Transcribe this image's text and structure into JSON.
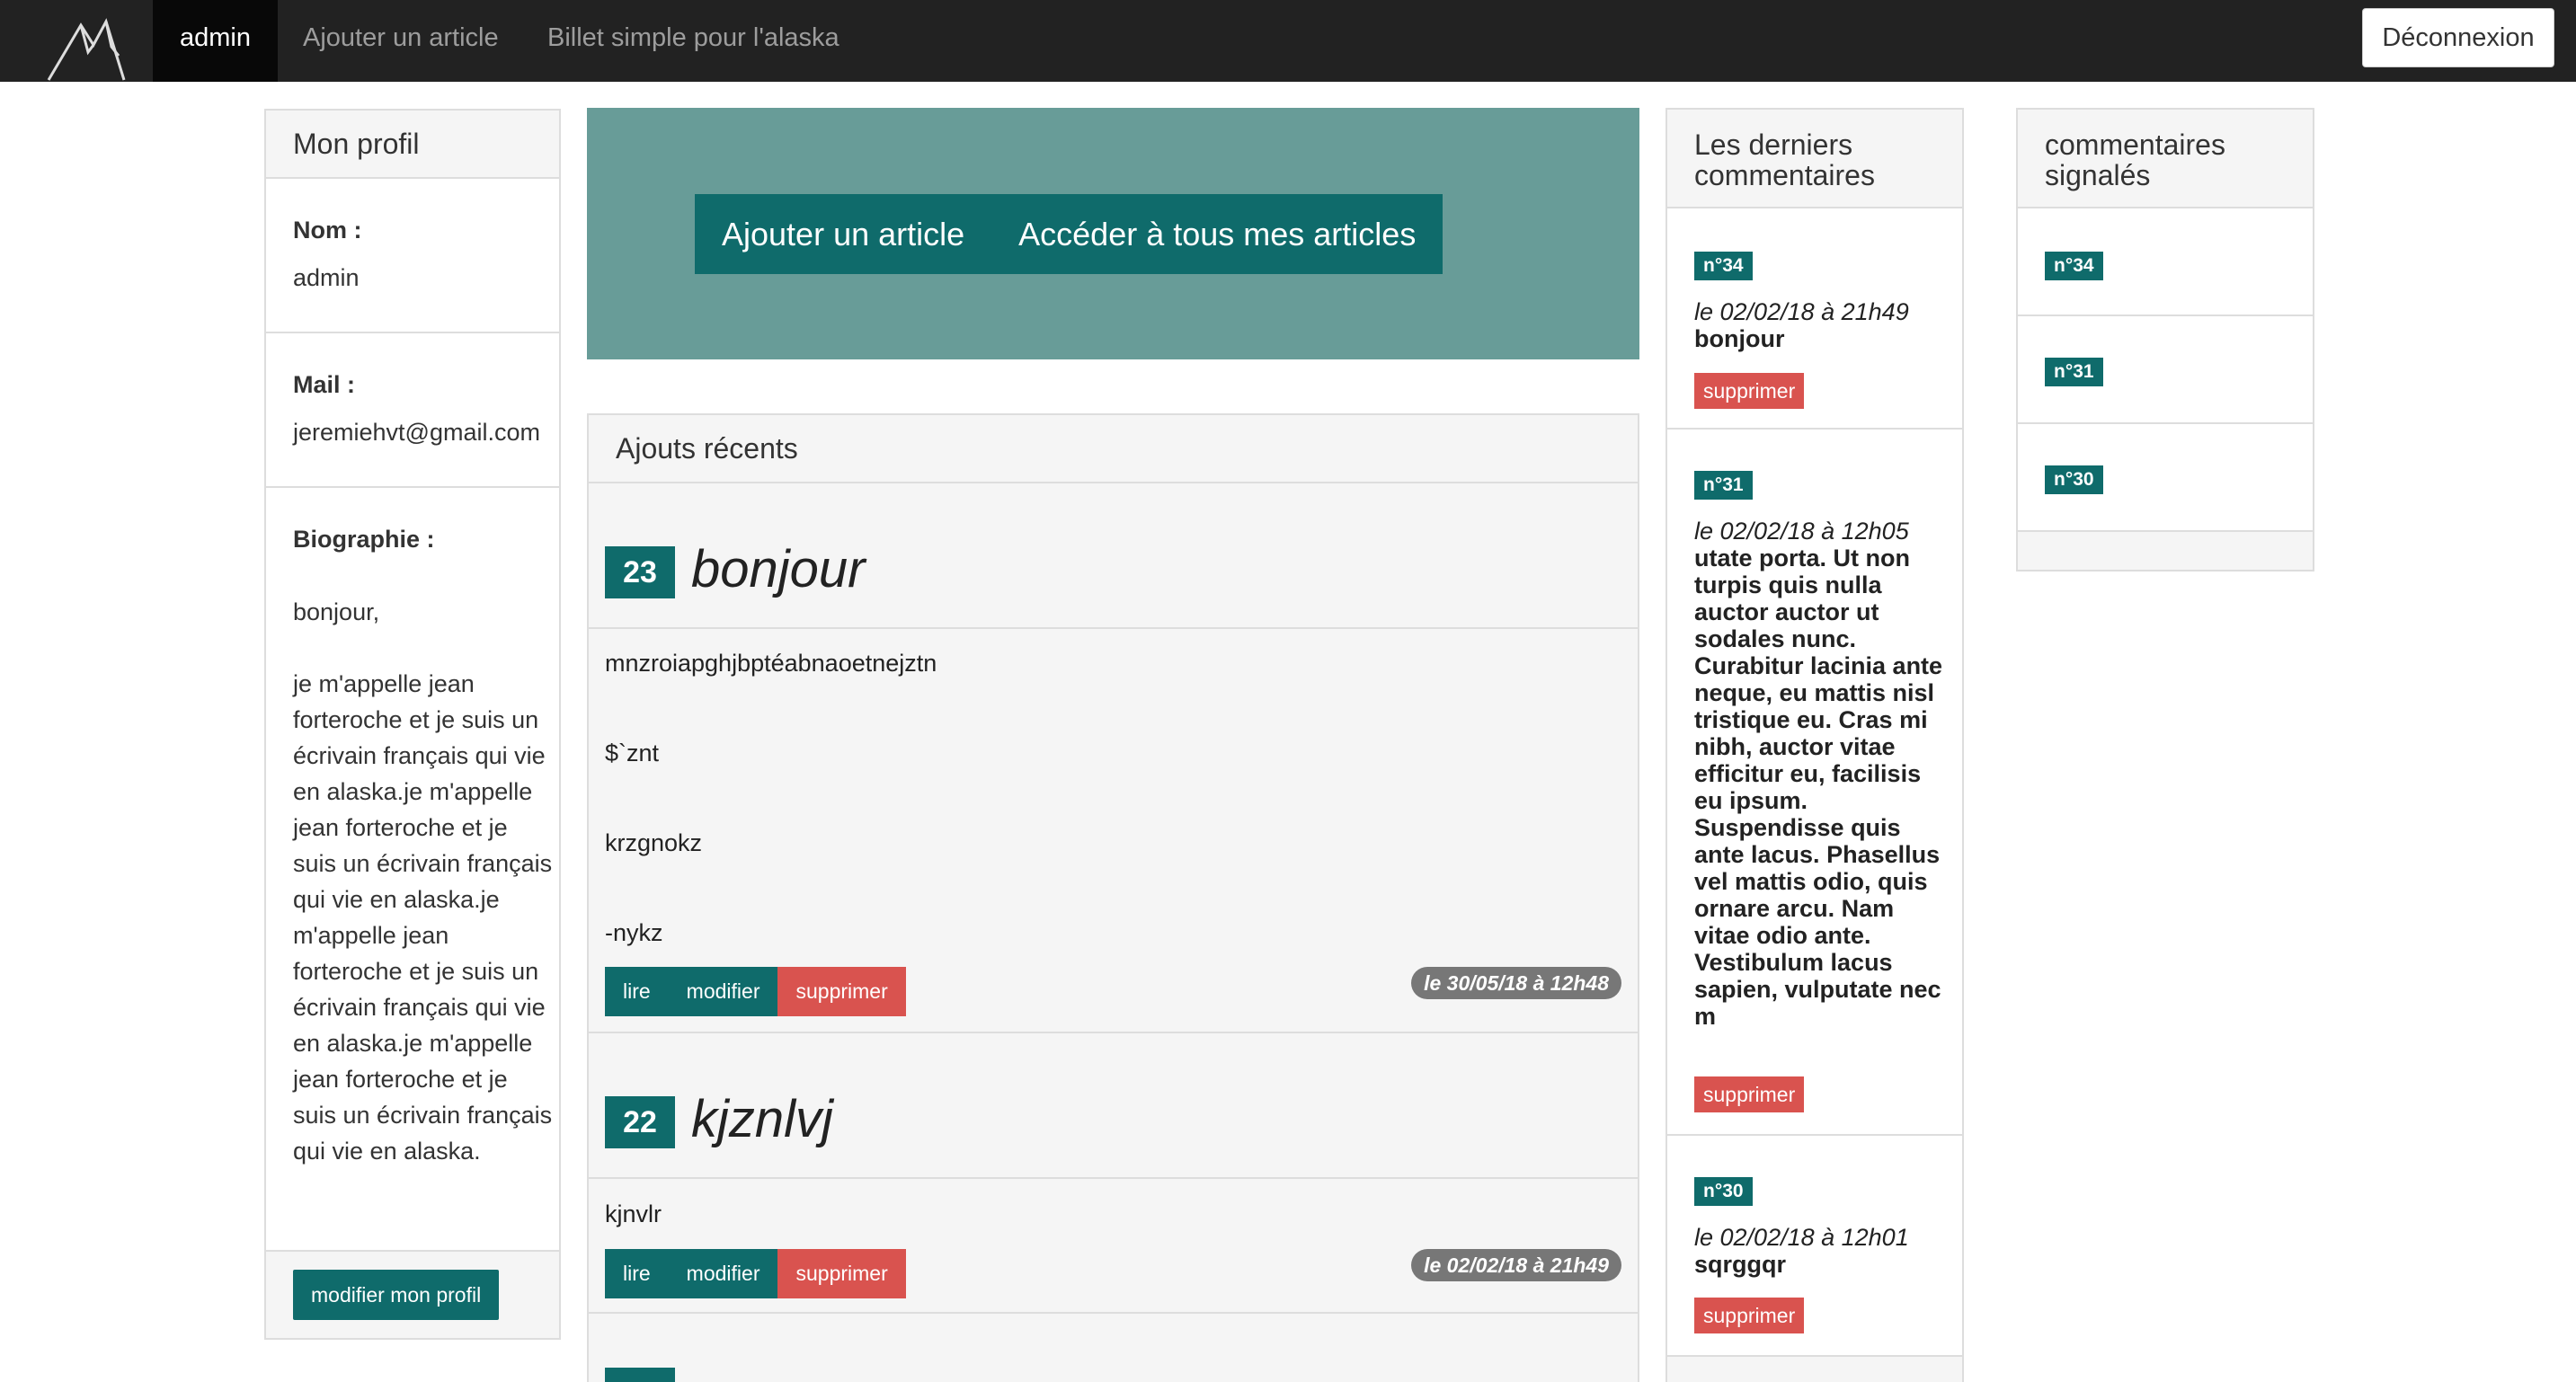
{
  "navbar": {
    "brand_icon": "mountain-icon",
    "items": [
      "admin",
      "Ajouter un article",
      "Billet simple pour l'alaska"
    ],
    "logout_label": "Déconnexion"
  },
  "profile": {
    "title": "Mon profil",
    "name_label": "Nom :",
    "name_value": "admin",
    "mail_label": "Mail :",
    "mail_value": "jeremiehvt@gmail.com",
    "bio_label": "Biographie :",
    "bio_value": "bonjour,\n\nje m'appelle jean forteroche et je suis un écrivain français qui vie en alaska.je m'appelle jean forteroche et je suis un écrivain français qui vie en alaska.je m'appelle jean forteroche et je suis un écrivain français qui vie en alaska.je m'appelle jean forteroche et je suis un écrivain français qui vie en alaska.",
    "edit_label": "modifier mon profil"
  },
  "actions": {
    "add_label": "Ajouter un article",
    "all_label": "Accéder à tous mes articles"
  },
  "recent": {
    "title": "Ajouts récents",
    "articles": [
      {
        "id": "23",
        "title": "bonjour",
        "lines": [
          "mnzroiapghjbptéabnaoetnejztn",
          "$`znt",
          "krzgnokz",
          "-nykz"
        ],
        "date": "le 30/05/18 à 12h48"
      },
      {
        "id": "22",
        "title": "kjznlvj",
        "lines": [
          "kjnvlr"
        ],
        "date": "le 02/02/18 à 21h49"
      }
    ],
    "read_label": "lire",
    "edit_label": "modifier",
    "delete_label": "supprimer"
  },
  "comments": {
    "title": "Les derniers commentaires",
    "items": [
      {
        "num": "n°34",
        "date": "le 02/02/18 à 21h49",
        "text": "bonjour"
      },
      {
        "num": "n°31",
        "date": "le 02/02/18 à 12h05",
        "text": "utate porta. Ut non turpis quis nulla auctor auctor ut sodales nunc. Curabitur lacinia ante neque, eu mattis nisl tristique eu. Cras mi nibh, auctor vitae efficitur eu, facilisis eu ipsum. Suspendisse quis ante lacus. Phasellus vel mattis odio, quis ornare arcu. Nam vitae odio ante. Vestibulum lacus sapien, vulputate nec m"
      },
      {
        "num": "n°30",
        "date": "le 02/02/18 à 12h01",
        "text": "sqrggqr"
      }
    ],
    "delete_label": "supprimer"
  },
  "reported": {
    "title": "commentaires signalés",
    "items": [
      "n°34",
      "n°31",
      "n°30"
    ]
  },
  "colors": {
    "navbar": "#222222",
    "teal": "#0f6b6b",
    "jumbotron": "#689c98",
    "danger": "#d9534f",
    "date_pill": "#777777"
  }
}
